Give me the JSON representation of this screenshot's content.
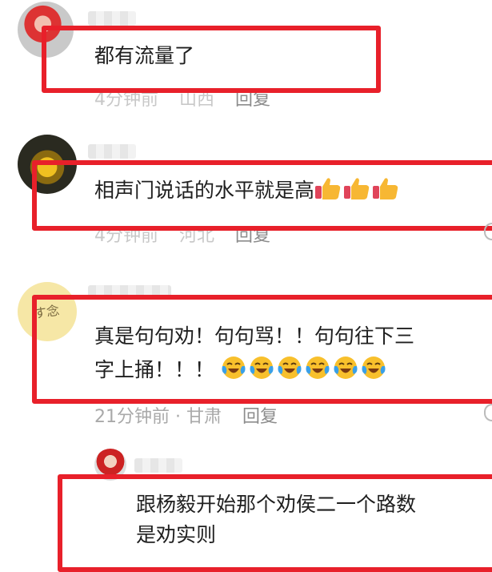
{
  "comments": [
    {
      "text": "都有流量了",
      "time": "4分钟前",
      "location": "山西",
      "reply": "回复"
    },
    {
      "text": "相声门说话的水平就是高",
      "emoji_count": 3,
      "emoji": "thumbs-up-icon",
      "time": "4分钟前",
      "location": "河北",
      "reply": "回复"
    },
    {
      "text_line1": "真是句句劝！句句骂！！句句往下三",
      "text_line2": "字上捅！！！",
      "emoji_count": 6,
      "emoji": "laughing-tears-icon",
      "meta": "21分钟前 · 甘肃",
      "reply": "回复"
    },
    {
      "text_line1": "跟杨毅开始那个劝侯二一个路数",
      "text_line2": "是劝实则"
    }
  ],
  "colors": {
    "highlight_box": "#e8202a",
    "meta_text": "#a9a9a9"
  }
}
